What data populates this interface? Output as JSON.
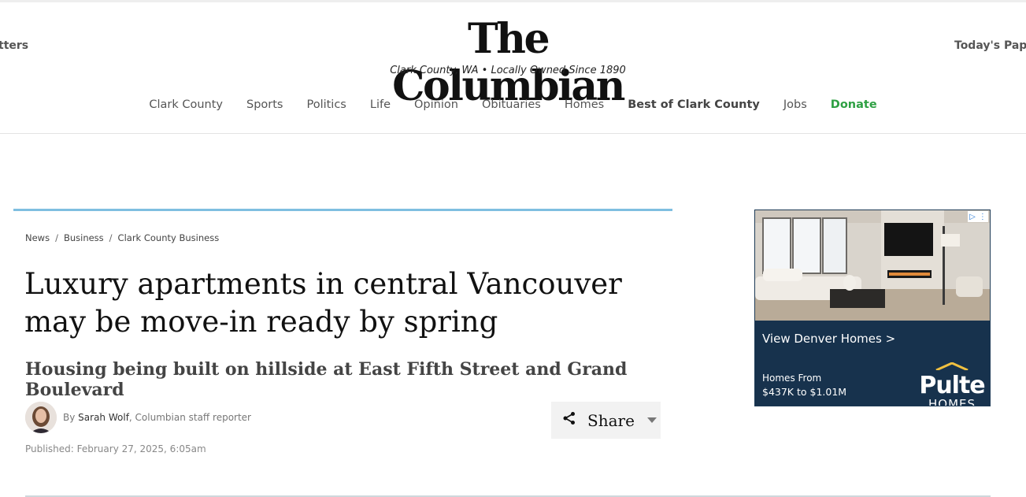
{
  "header": {
    "left_link": "tters",
    "right_link": "Today's Pape",
    "logo": "The Columbian",
    "tagline": "Clark County, WA • Locally Owned Since 1890"
  },
  "nav": {
    "items": [
      {
        "label": "Clark County"
      },
      {
        "label": "Sports"
      },
      {
        "label": "Politics"
      },
      {
        "label": "Life"
      },
      {
        "label": "Opinion"
      },
      {
        "label": "Obituaries"
      },
      {
        "label": "Homes"
      },
      {
        "label": "Best of Clark County"
      },
      {
        "label": "Jobs"
      },
      {
        "label": "Donate"
      }
    ]
  },
  "breadcrumb": {
    "items": [
      "News",
      "Business",
      "Clark County Business"
    ],
    "separator": "/"
  },
  "article": {
    "headline": "Luxury apartments in central Vancouver may be move-in ready by spring",
    "subhead": "Housing being built on hillside at East Fifth Street and Grand Boulevard",
    "byline_prefix": "By",
    "author": "Sarah Wolf",
    "author_role": ", Columbian staff reporter",
    "published": "Published: February 27, 2025, 6:05am"
  },
  "share": {
    "label": "Share",
    "icon": "share-icon"
  },
  "ad": {
    "cta": "View Denver Homes >",
    "from": "Homes From",
    "price": "$437K to $1.01M",
    "brand": "Pulte",
    "brand_sub": "HOMES"
  },
  "colors": {
    "accent_rule": "#7fbfe0",
    "donate": "#2ea043",
    "ad_bg": "#17324d"
  }
}
